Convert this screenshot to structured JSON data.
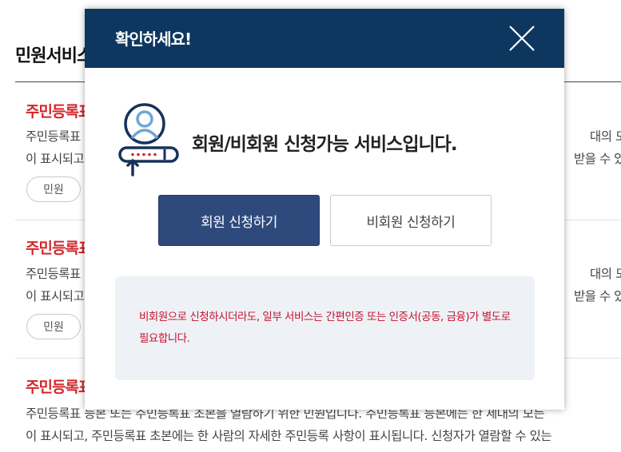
{
  "background": {
    "page_title": "민원서비스",
    "services": [
      {
        "title": "주민등록표",
        "desc_line1": "주민등록표",
        "desc_line1_right": "대의 모든",
        "desc_line2": "이 표시되고",
        "desc_line2_right": "받을 수 있",
        "tag": "민원"
      },
      {
        "title": "주민등록표",
        "desc_line1": "주민등록표",
        "desc_line1_right": "대의 모든",
        "desc_line2": "이 표시되고",
        "desc_line2_right": "받을 수 있",
        "tag": "민원"
      },
      {
        "title": "주민등록표",
        "desc_line1": "주민등록표 등본 또는 주민등록표 초본을 열람하기 위한 민원입니다. 주민등록표 등본에는 한 세대의 모든",
        "desc_line2": "이 표시되고, 주민등록표 초본에는 한 사람의 자세한 주민등록 사항이 표시됩니다. 신청자가 열람할 수 있는"
      }
    ]
  },
  "modal": {
    "title": "확인하세요!",
    "close_icon": "close-icon",
    "notice_icon": "user-login-icon",
    "notice": "회원/비회원 신청가능 서비스입니다.",
    "member_button": "회원 신청하기",
    "nonmember_button": "비회원 신청하기",
    "info_text": "비회원으로 신청하시더라도, 일부 서비스는 간편인증 또는 인증서(공동, 금융)가 별도로 필요합니다."
  },
  "colors": {
    "header_bg": "#0e3760",
    "primary_button": "#2e4a7d",
    "accent_red": "#d4262b",
    "info_text": "#c8102e",
    "info_bg": "#eef2f6"
  }
}
